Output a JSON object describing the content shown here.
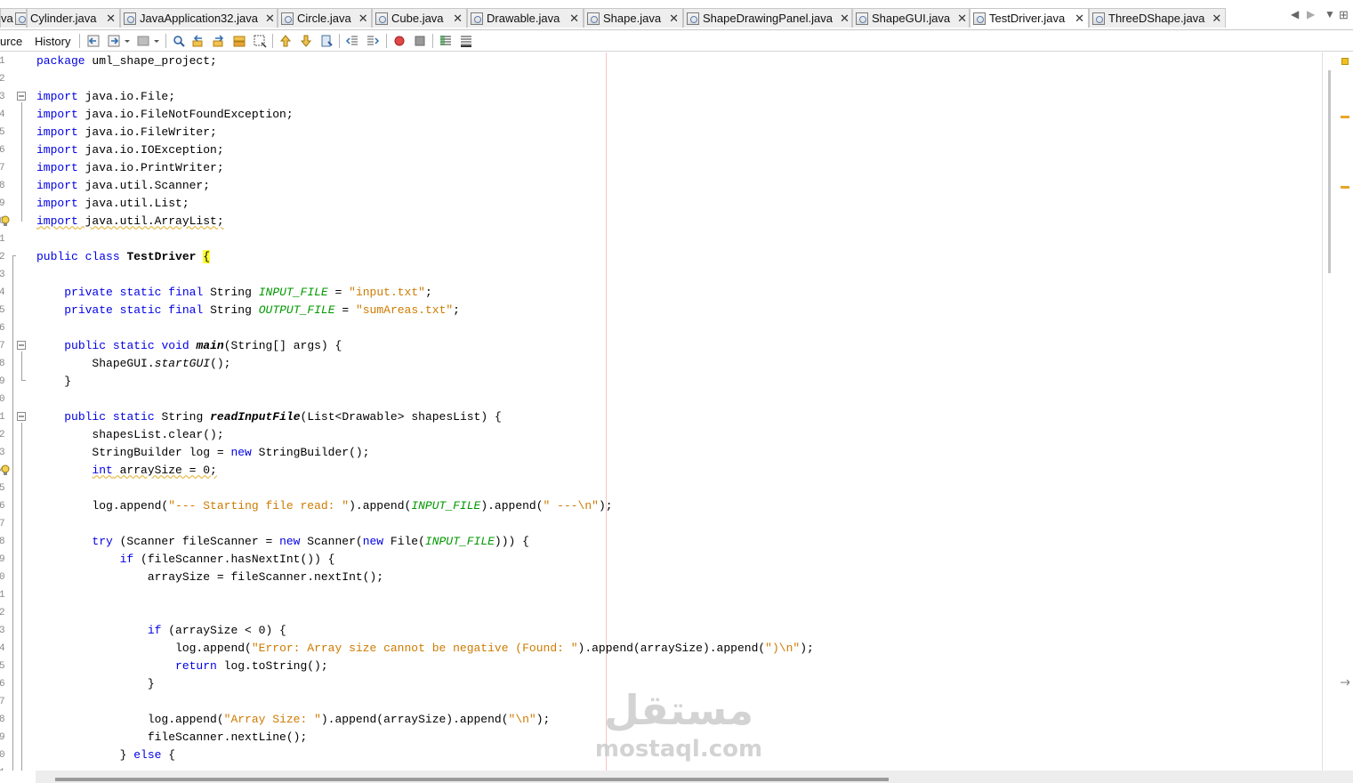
{
  "editor_tabs": [
    {
      "label": "va",
      "close": "",
      "active": false
    },
    {
      "label": "Cylinder.java",
      "close": "✕",
      "active": false
    },
    {
      "label": "JavaApplication32.java",
      "close": "✕",
      "active": false
    },
    {
      "label": "Circle.java",
      "close": "✕",
      "active": false
    },
    {
      "label": "Cube.java",
      "close": "✕",
      "active": false
    },
    {
      "label": "Drawable.java",
      "close": "✕",
      "active": false
    },
    {
      "label": "Shape.java",
      "close": "✕",
      "active": false
    },
    {
      "label": "ShapeDrawingPanel.java",
      "close": "✕",
      "active": false
    },
    {
      "label": "ShapeGUI.java",
      "close": "✕",
      "active": false
    },
    {
      "label": "TestDriver.java",
      "close": "✕",
      "active": true
    },
    {
      "label": "ThreeDShape.java",
      "close": "✕",
      "active": false
    }
  ],
  "tab_nav": {
    "prev": "◀",
    "next": "▶",
    "list": "▼",
    "maximize": "⊞"
  },
  "view_tabs": {
    "source": "urce",
    "history": "History"
  },
  "toolbar_icons": [
    "back-icon",
    "forward-icon",
    "dropdown-icon",
    "last-edit-icon",
    "find-icon",
    "find-prev-icon",
    "find-next-icon",
    "toggle-highlight-icon",
    "toggle-rect-select-icon",
    "prev-bookmark-icon",
    "next-bookmark-icon",
    "toggle-bookmark-icon",
    "shift-left-icon",
    "shift-right-icon",
    "record-macro-icon",
    "stop-macro-icon",
    "comment-icon",
    "uncomment-icon"
  ],
  "line_numbers": [
    "1",
    "2",
    "3",
    "4",
    "5",
    "6",
    "7",
    "8",
    "9",
    "0",
    "1",
    "2",
    "3",
    "4",
    "5",
    "6",
    "7",
    "8",
    "9",
    "0",
    "1",
    "2",
    "3",
    "4",
    "5",
    "6",
    "7",
    "8",
    "9",
    "0",
    "1",
    "2",
    "3",
    "4",
    "5",
    "6",
    "7",
    "8",
    "9",
    "0",
    "1"
  ],
  "code": {
    "package_kw": "package",
    "package_name": " uml_shape_project;",
    "import_kw": "import",
    "imports": [
      " java.io.File;",
      " java.io.FileNotFoundException;",
      " java.io.FileWriter;",
      " java.io.IOException;",
      " java.io.PrintWriter;",
      " java.util.Scanner;",
      " java.util.List;",
      " java.util.ArrayList;"
    ],
    "public": "public",
    "static": "static",
    "final": "final",
    "class_kw": "class",
    "class_name": "TestDriver",
    "open_brace": "{",
    "private": "private",
    "String": "String",
    "input_const": "INPUT_FILE",
    "input_val": "\"input.txt\"",
    "output_const": "OUTPUT_FILE",
    "output_val": "\"sumAreas.txt\"",
    "void": "void",
    "main_name": "main",
    "main_params": "(String[] args) {",
    "shapegui": "ShapeGUI.",
    "startgui": "startGUI",
    "startgui_tail": "();",
    "close_brace": "}",
    "read_name": "readInputFile",
    "read_params": "(List<Drawable> shapesList) {",
    "l22": "shapesList.clear();",
    "l23a": "StringBuilder log = ",
    "new_kw": "new",
    "l23b": " StringBuilder();",
    "int_kw": "int",
    "l24": " arraySize = 0;",
    "l26a": "log.append(",
    "l26s1": "\"--- Starting file read: \"",
    "l26b": ").append(",
    "l26c": ").append(",
    "l26s2": "\" ---\\n\"",
    "l26d": ");",
    "try_kw": "try",
    "l28a": " (Scanner fileScanner = ",
    "l28b": " Scanner(",
    "l28c": " File(",
    "l28d": "))) {",
    "if_kw": "if",
    "l29": " (fileScanner.hasNextInt()) {",
    "l30": "arraySize = fileScanner.nextInt();",
    "l33": " (arraySize < 0) {",
    "l34a": "log.append(",
    "l34s1": "\"Error: Array size cannot be negative (Found: \"",
    "l34b": ").append(arraySize).append(",
    "l34s2": "\")\\n\"",
    "l34c": ");",
    "return_kw": "return",
    "l35": " log.toString();",
    "l38a": "log.append(",
    "l38s1": "\"Array Size: \"",
    "l38b": ").append(arraySize).append(",
    "l38s2": "\"\\n\"",
    "l38c": ");",
    "l39": "fileScanner.nextLine();",
    "l40a": "} ",
    "else_kw": "else",
    "l40b": " {"
  },
  "watermark": {
    "arabic": "مستقل",
    "latin": "mostaql.com"
  },
  "colors": {
    "keyword": "#0000e6",
    "string": "#ce7b00",
    "constant": "#009900",
    "highlight": "#ffff33"
  }
}
